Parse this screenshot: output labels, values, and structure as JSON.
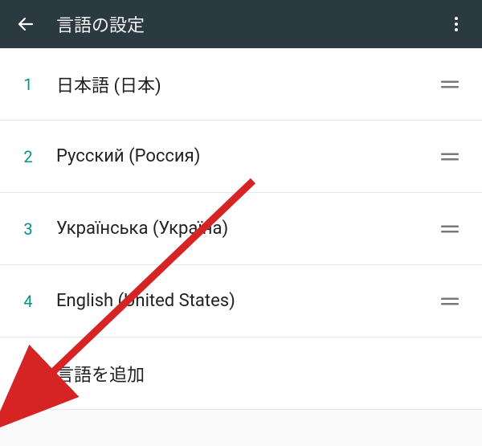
{
  "header": {
    "title": "言語の設定"
  },
  "languages": [
    {
      "index": "1",
      "label": "日本語 (日本)"
    },
    {
      "index": "2",
      "label": "Русский (Россия)"
    },
    {
      "index": "3",
      "label": "Українська (Україна)"
    },
    {
      "index": "4",
      "label": "English (United States)"
    }
  ],
  "add": {
    "label": "言語を追加"
  },
  "colors": {
    "header_bg": "#2b3940",
    "accent": "#009688",
    "arrow": "#d62424"
  }
}
